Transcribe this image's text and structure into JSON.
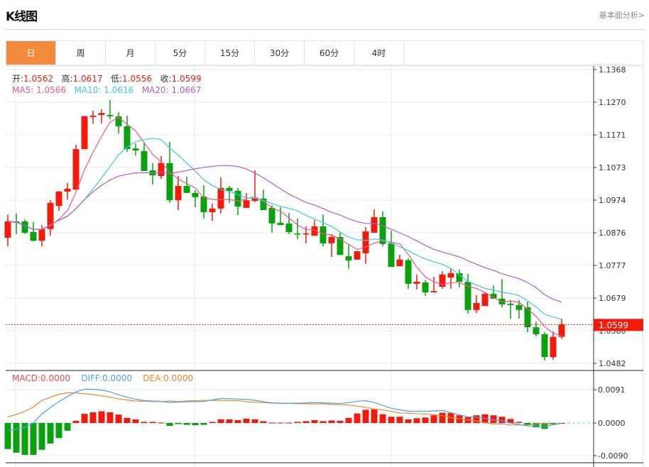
{
  "header": {
    "title": "K线图",
    "link": "基本面分析>"
  },
  "tabs": [
    {
      "label": "日",
      "active": true
    },
    {
      "label": "周"
    },
    {
      "label": "月"
    },
    {
      "label": "5分"
    },
    {
      "label": "15分"
    },
    {
      "label": "30分"
    },
    {
      "label": "60分"
    },
    {
      "label": "4时"
    }
  ],
  "ohlc_info": {
    "open_label": "开:",
    "open": "1.0562",
    "high_label": "高:",
    "high": "1.0617",
    "low_label": "低:",
    "low": "1.0556",
    "close_label": "收:",
    "close": "1.0599"
  },
  "ma_info": {
    "ma5_label": "MA5:",
    "ma5": "1.0566",
    "ma10_label": "MA10:",
    "ma10": "1.0616",
    "ma20_label": "MA20:",
    "ma20": "1.0667"
  },
  "macd_info": {
    "macd_label": "MACD:",
    "macd": "0.0000",
    "diff_label": "DIFF:",
    "diff": "0.0000",
    "dea_label": "DEA:",
    "dea": "0.0000"
  },
  "current_price_label": "1.0599",
  "colors": {
    "up": "#f21a0a",
    "down": "#08a30c",
    "ma5": "#f0568a",
    "ma10": "#3dc8e0",
    "ma20": "#b45cc9",
    "diff": "#4aa3ef",
    "dea": "#f7862a",
    "accent": "#f28c3c"
  },
  "chart_data": [
    {
      "type": "candlestick",
      "title": "K线图",
      "yticks": [
        "1.1368",
        "1.1270",
        "1.1171",
        "1.1073",
        "1.0974",
        "1.0876",
        "1.0777",
        "1.0679",
        "1.0580",
        "1.0482"
      ],
      "ylim": [
        1.0482,
        1.1368
      ],
      "last_price": 1.0599,
      "grid": true,
      "ohlc": [
        [
          1.0861,
          1.0931,
          1.0835,
          1.091
        ],
        [
          1.091,
          1.0934,
          1.0872,
          1.0906
        ],
        [
          1.091,
          1.0916,
          1.0872,
          1.0876
        ],
        [
          1.0878,
          1.0908,
          1.085,
          1.0852
        ],
        [
          1.0852,
          1.0899,
          1.0835,
          1.0887
        ],
        [
          1.0887,
          1.0974,
          1.0867,
          1.0966
        ],
        [
          1.0957,
          1.1002,
          1.0942,
          1.1
        ],
        [
          1.1,
          1.1026,
          1.0976,
          1.1009
        ],
        [
          1.1006,
          1.1141,
          1.1006,
          1.1128
        ],
        [
          1.1128,
          1.1229,
          1.1128,
          1.1227
        ],
        [
          1.1225,
          1.1244,
          1.1205,
          1.1229
        ],
        [
          1.1231,
          1.1248,
          1.1205,
          1.1237
        ],
        [
          1.1231,
          1.1276,
          1.1218,
          1.1227
        ],
        [
          1.1227,
          1.124,
          1.1175,
          1.1197
        ],
        [
          1.1197,
          1.1229,
          1.112,
          1.1128
        ],
        [
          1.113,
          1.1145,
          1.1109,
          1.1124
        ],
        [
          1.1122,
          1.1148,
          1.1062,
          1.1062
        ],
        [
          1.1064,
          1.1086,
          1.1021,
          1.1049
        ],
        [
          1.1047,
          1.1107,
          1.1038,
          1.1086
        ],
        [
          1.1086,
          1.115,
          1.0966,
          1.0974
        ],
        [
          1.0974,
          1.1047,
          1.0944,
          1.1017
        ],
        [
          1.1017,
          1.1045,
          1.0996,
          1.0996
        ],
        [
          1.0996,
          1.1004,
          1.0953,
          1.0983
        ],
        [
          1.0985,
          1.1019,
          1.0919,
          1.0938
        ],
        [
          1.0938,
          1.0964,
          1.0912,
          1.0949
        ],
        [
          1.0949,
          1.1043,
          1.0934,
          1.1011
        ],
        [
          1.1011,
          1.1017,
          1.0966,
          1.1002
        ],
        [
          1.1002,
          1.1011,
          1.0929,
          1.0955
        ],
        [
          1.0951,
          1.0996,
          1.0951,
          1.0974
        ],
        [
          1.0972,
          1.1064,
          1.0968,
          1.0979
        ],
        [
          1.0979,
          1.1006,
          1.0944,
          1.0944
        ],
        [
          1.0951,
          1.0959,
          1.0876,
          1.0904
        ],
        [
          1.0906,
          1.0953,
          1.0899,
          1.0899
        ],
        [
          1.0904,
          1.0936,
          1.0872,
          1.0878
        ],
        [
          1.0874,
          1.0919,
          1.0857,
          1.0872
        ],
        [
          1.0872,
          1.0895,
          1.0844,
          1.0874
        ],
        [
          1.0867,
          1.0914,
          1.0867,
          1.0895
        ],
        [
          1.0895,
          1.0931,
          1.0835,
          1.0844
        ],
        [
          1.0844,
          1.0872,
          1.0803,
          1.0863
        ],
        [
          1.0863,
          1.0876,
          1.0809,
          1.0809
        ],
        [
          1.0805,
          1.0842,
          1.0767,
          1.0792
        ],
        [
          1.0795,
          1.0822,
          1.0795,
          1.082
        ],
        [
          1.0814,
          1.0893,
          1.0782,
          1.088
        ],
        [
          1.0876,
          1.0946,
          1.0876,
          1.0923
        ],
        [
          1.0923,
          1.094,
          1.0835,
          1.0842
        ],
        [
          1.0844,
          1.0882,
          1.0773,
          1.0773
        ],
        [
          1.0775,
          1.0809,
          1.0775,
          1.0795
        ],
        [
          1.0793,
          1.0799,
          1.0707,
          1.0722
        ],
        [
          1.0722,
          1.075,
          1.0705,
          1.0728
        ],
        [
          1.0726,
          1.0733,
          1.0685,
          1.0696
        ],
        [
          1.0696,
          1.0743,
          1.0696,
          1.07
        ],
        [
          1.0713,
          1.076,
          1.0707,
          1.075
        ],
        [
          1.0741,
          1.0767,
          1.0707,
          1.0754
        ],
        [
          1.0754,
          1.0765,
          1.0711,
          1.0728
        ],
        [
          1.0728,
          1.0752,
          1.0632,
          1.0643
        ],
        [
          1.0643,
          1.0688,
          1.0634,
          1.0664
        ],
        [
          1.0655,
          1.0696,
          1.0655,
          1.0692
        ],
        [
          1.0692,
          1.0717,
          1.0677,
          1.0677
        ],
        [
          1.0677,
          1.0736,
          1.0651,
          1.066
        ],
        [
          1.0662,
          1.0673,
          1.0617,
          1.0658
        ],
        [
          1.0658,
          1.0673,
          1.0617,
          1.0643
        ],
        [
          1.0651,
          1.0668,
          1.0576,
          1.0591
        ],
        [
          1.0591,
          1.0608,
          1.0563,
          1.057
        ],
        [
          1.057,
          1.0576,
          1.0491,
          1.0501
        ],
        [
          1.0501,
          1.0578,
          1.0493,
          1.0562
        ],
        [
          1.0562,
          1.0617,
          1.0556,
          1.0599
        ]
      ],
      "moving_averages": [
        "MA5",
        "MA10",
        "MA20"
      ]
    },
    {
      "type": "bar+line",
      "title": "MACD",
      "yticks": [
        "0.0091",
        "0.0000",
        "-0.0090"
      ],
      "ylim": [
        -0.0091,
        0.0091
      ],
      "macd": [
        -0.0071,
        -0.0081,
        -0.0087,
        -0.0087,
        -0.0073,
        -0.0056,
        -0.0041,
        -0.0021,
        0.0006,
        0.0025,
        0.0029,
        0.0032,
        0.0029,
        0.0023,
        0.0014,
        0.001,
        0.0003,
        0.0003,
        0.0001,
        -0.0008,
        -0.0003,
        -0.0005,
        -0.0006,
        -0.0005,
        0.0003,
        0.001,
        0.001,
        0.0008,
        0.0012,
        0.001,
        0.0005,
        0.0001,
        0.0001,
        0.0001,
        0.0003,
        0.0005,
        0.0008,
        0.0005,
        0.0007,
        0.0006,
        0.0014,
        0.0026,
        0.0036,
        0.0037,
        0.0024,
        0.0017,
        0.0017,
        0.001,
        0.0013,
        0.0015,
        0.0021,
        0.0028,
        0.0027,
        0.0021,
        0.0016,
        0.0021,
        0.0024,
        0.0021,
        0.0017,
        0.0011,
        0.0003,
        -0.0005,
        -0.0012,
        -0.0016,
        -0.0003,
        0.0
      ],
      "diff": [
        -0.0019,
        -0.0017,
        -0.0012,
        0.0,
        0.0025,
        0.0042,
        0.0058,
        0.0072,
        0.0085,
        0.0092,
        0.0092,
        0.009,
        0.0085,
        0.0077,
        0.007,
        0.0065,
        0.0061,
        0.006,
        0.0059,
        0.0056,
        0.0057,
        0.0058,
        0.0058,
        0.0059,
        0.0063,
        0.0067,
        0.0066,
        0.0065,
        0.0064,
        0.0062,
        0.0058,
        0.0055,
        0.0054,
        0.0054,
        0.0054,
        0.0055,
        0.0056,
        0.0055,
        0.0054,
        0.0053,
        0.0056,
        0.0059,
        0.0061,
        0.0056,
        0.0048,
        0.004,
        0.0036,
        0.0032,
        0.0032,
        0.0032,
        0.0033,
        0.0034,
        0.0028,
        0.0022,
        0.0017,
        0.0016,
        0.0013,
        0.0008,
        0.0006,
        0.0,
        -0.0004,
        -0.0008,
        -0.0009,
        -0.001,
        -0.0005,
        -0.0001
      ]
    }
  ]
}
